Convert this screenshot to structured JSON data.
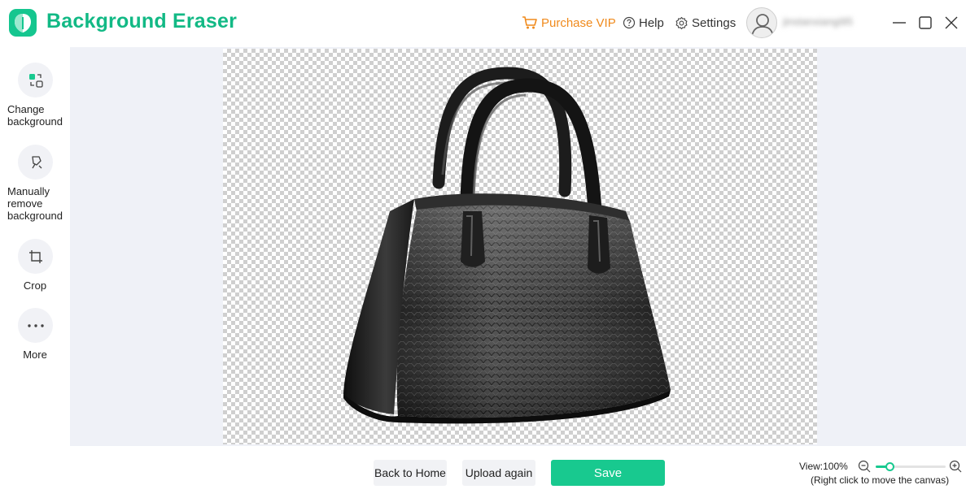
{
  "app": {
    "title": "Background Eraser",
    "accent_color": "#15c68f",
    "vip_color": "#f08a1c"
  },
  "header": {
    "purchase_vip": "Purchase VIP",
    "help": "Help",
    "settings": "Settings",
    "username": "jinstanxiangi95",
    "icons": [
      "cart-icon",
      "help-circle-icon",
      "gear-icon",
      "user-icon",
      "minimize-icon",
      "maximize-icon",
      "close-icon"
    ]
  },
  "sidebar": {
    "tools": [
      {
        "label": "Change background",
        "icon": "swap-background-icon"
      },
      {
        "label": "Manually remove background",
        "icon": "brush-icon"
      },
      {
        "label": "Crop",
        "icon": "crop-icon"
      },
      {
        "label": "More",
        "icon": "more-dots-icon"
      }
    ]
  },
  "canvas": {
    "content": "handbag-image",
    "background": "transparency-checkerboard"
  },
  "footer": {
    "back_to_home": "Back to Home",
    "upload_again": "Upload again",
    "save": "Save",
    "view_label": "View:100%",
    "zoom_level": 0.2,
    "hint": "(Right click to move the canvas)"
  }
}
